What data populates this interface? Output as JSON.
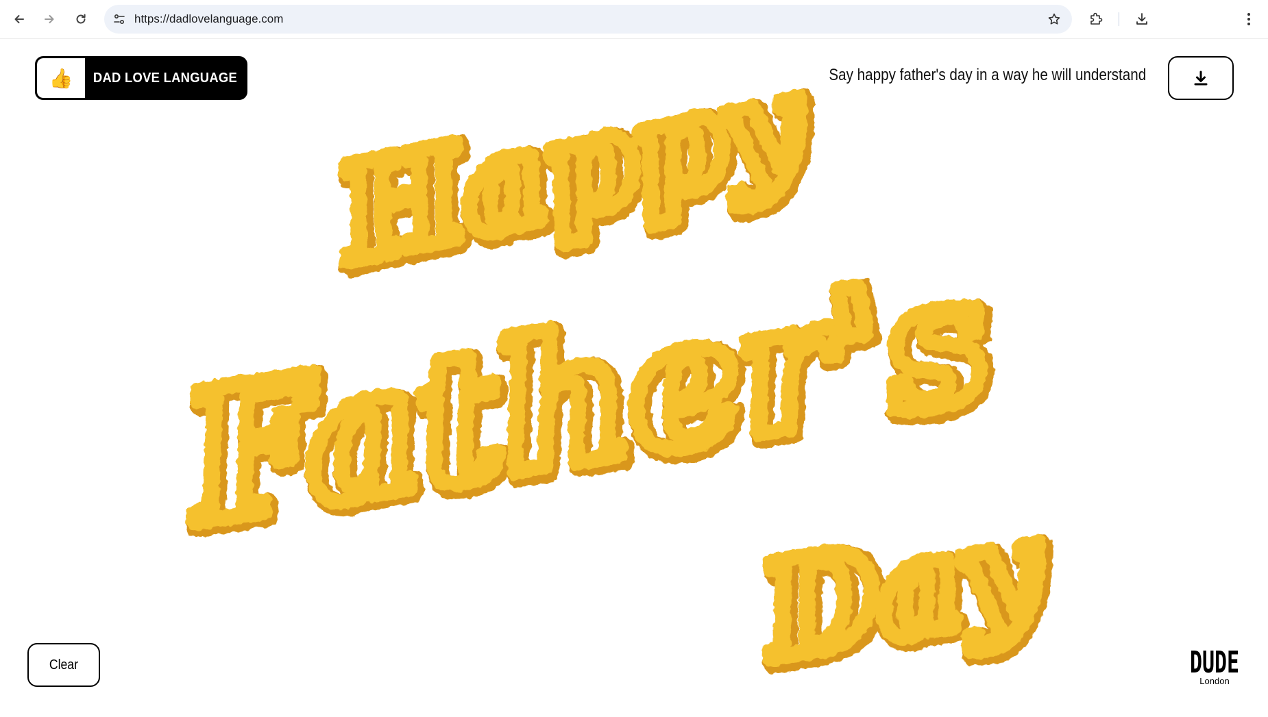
{
  "browser": {
    "url": "https://dadlovelanguage.com"
  },
  "header": {
    "brand_emoji": "👍",
    "brand_label": "DAD LOVE LANGUAGE",
    "tagline": "Say happy father's day in a way he will understand"
  },
  "artwork": {
    "lines": [
      "Happy",
      "Father's",
      "Day"
    ],
    "color": "#f5c12e",
    "shadow_color": "#d9971a"
  },
  "controls": {
    "clear_label": "Clear"
  },
  "footer": {
    "logo_text": "DUDE",
    "logo_sub": "London"
  }
}
